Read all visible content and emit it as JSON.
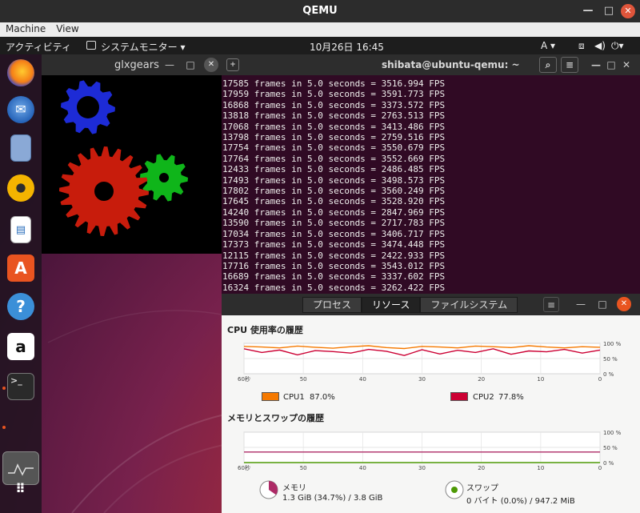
{
  "qemu": {
    "title": "QEMU",
    "menu": [
      "Machine",
      "View"
    ]
  },
  "topbar": {
    "activities": "アクティビティ",
    "app_menu": "システムモニター ▾",
    "clock": "10月26日  16:45",
    "input_method": "A ▾"
  },
  "dock": {
    "items": [
      "firefox",
      "thunderbird",
      "files",
      "rhythmbox",
      "libreoffice-writer",
      "ubuntu-software",
      "help",
      "amazon",
      "terminal",
      "system-monitor",
      "show-applications"
    ]
  },
  "glxgears": {
    "title": "glxgears",
    "gear_colors": {
      "red": "#c81c0c",
      "green": "#0fb51a",
      "blue": "#1d2bd6"
    }
  },
  "terminal": {
    "title": "shibata@ubuntu-qemu: ~",
    "lines": [
      "17585 frames in 5.0 seconds = 3516.994 FPS",
      "17959 frames in 5.0 seconds = 3591.773 FPS",
      "16868 frames in 5.0 seconds = 3373.572 FPS",
      "13818 frames in 5.0 seconds = 2763.513 FPS",
      "17068 frames in 5.0 seconds = 3413.486 FPS",
      "13798 frames in 5.0 seconds = 2759.516 FPS",
      "17754 frames in 5.0 seconds = 3550.679 FPS",
      "17764 frames in 5.0 seconds = 3552.669 FPS",
      "12433 frames in 5.0 seconds = 2486.485 FPS",
      "17493 frames in 5.0 seconds = 3498.573 FPS",
      "17802 frames in 5.0 seconds = 3560.249 FPS",
      "17645 frames in 5.0 seconds = 3528.920 FPS",
      "14240 frames in 5.0 seconds = 2847.969 FPS",
      "13590 frames in 5.0 seconds = 2717.783 FPS",
      "17034 frames in 5.0 seconds = 3406.717 FPS",
      "17373 frames in 5.0 seconds = 3474.448 FPS",
      "12115 frames in 5.0 seconds = 2422.933 FPS",
      "17716 frames in 5.0 seconds = 3543.012 FPS",
      "16689 frames in 5.0 seconds = 3337.602 FPS",
      "16324 frames in 5.0 seconds = 3262.422 FPS"
    ]
  },
  "sysmon": {
    "tabs": [
      "プロセス",
      "リソース",
      "ファイルシステム"
    ],
    "active_tab": 1,
    "cpu_section": "CPU 使用率の履歴",
    "mem_section": "メモリとスワップの履歴",
    "x_ticks": [
      "60秒",
      "50",
      "40",
      "30",
      "20",
      "10",
      "0"
    ],
    "y_ticks": [
      "100 %",
      "50 %",
      "0 %"
    ],
    "cpu1": {
      "label": "CPU1",
      "value": "87.0%",
      "color": "#f57900"
    },
    "cpu2": {
      "label": "CPU2",
      "value": "77.8%",
      "color": "#cc0033"
    },
    "memory": {
      "label": "メモリ",
      "detail": "1.3 GiB (34.7%) / 3.8 GiB",
      "fraction": 0.347,
      "color": "#ad2a66"
    },
    "swap": {
      "label": "スワップ",
      "detail": "0 バイト (0.0%) / 947.2 MiB",
      "fraction": 0.0,
      "color": "#4e9a06"
    }
  },
  "chart_data": [
    {
      "type": "line",
      "title": "CPU 使用率の履歴",
      "x": [
        60,
        57,
        54,
        51,
        48,
        45,
        42,
        39,
        36,
        33,
        30,
        27,
        24,
        21,
        18,
        15,
        12,
        9,
        6,
        3,
        0
      ],
      "series": [
        {
          "name": "CPU1",
          "values": [
            90,
            88,
            85,
            91,
            87,
            84,
            89,
            92,
            86,
            83,
            90,
            88,
            85,
            91,
            89,
            86,
            92,
            88,
            85,
            89,
            87
          ]
        },
        {
          "name": "CPU2",
          "values": [
            82,
            70,
            78,
            62,
            76,
            73,
            68,
            80,
            74,
            60,
            79,
            65,
            77,
            70,
            82,
            64,
            75,
            72,
            80,
            68,
            78
          ]
        }
      ],
      "ylim": [
        0,
        100
      ]
    },
    {
      "type": "line",
      "title": "メモリとスワップの履歴",
      "x": [
        60,
        0
      ],
      "series": [
        {
          "name": "メモリ",
          "values": [
            34.7,
            34.7
          ]
        },
        {
          "name": "スワップ",
          "values": [
            0,
            0
          ]
        }
      ],
      "ylim": [
        0,
        100
      ]
    }
  ]
}
